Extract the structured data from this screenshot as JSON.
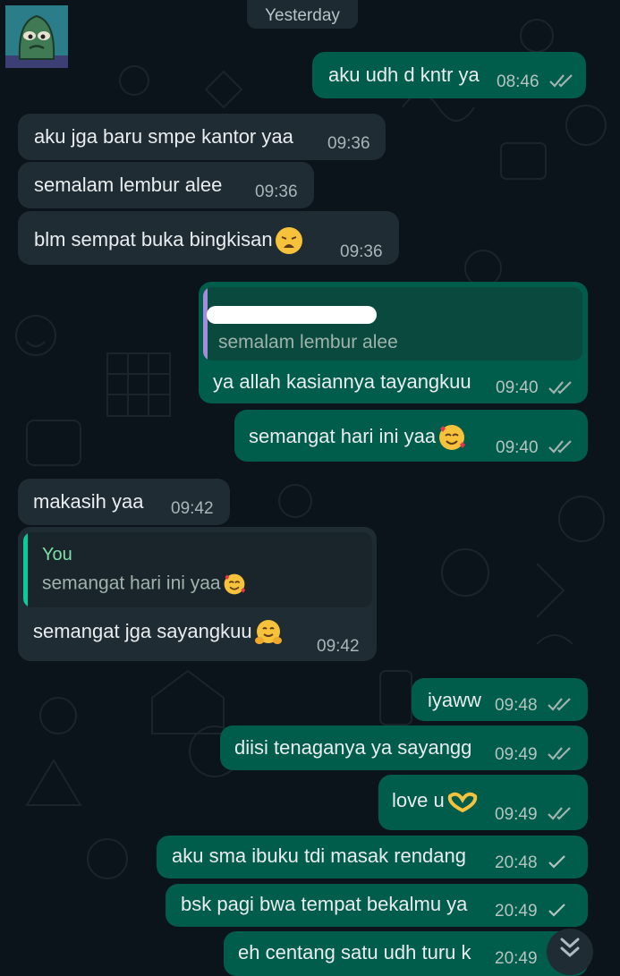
{
  "date_chip": "Yesterday",
  "messages": [
    {
      "text": "aku udh d kntr ya",
      "time": "08:46",
      "status": "read"
    },
    {
      "text": "aku jga baru smpe kantor yaa",
      "time": "09:36"
    },
    {
      "text": "semalam lembur alee",
      "time": "09:36"
    },
    {
      "text": "blm sempat buka bingkisan",
      "time": "09:36",
      "emoji": "weary-face"
    },
    {
      "reply_to_text": "semalam lembur alee",
      "text": "ya allah kasiannya tayangkuu",
      "time": "09:40",
      "status": "read"
    },
    {
      "text": "semangat hari ini yaa",
      "time": "09:40",
      "status": "read",
      "emoji": "smiling-face-with-hearts"
    },
    {
      "text": "makasih yaa",
      "time": "09:42"
    },
    {
      "reply_to_author": "You",
      "reply_to_text": "semangat hari ini yaa",
      "text": "semangat jga sayangkuu",
      "time": "09:42",
      "emoji": "hugging-face"
    },
    {
      "text": "iyaww",
      "time": "09:48",
      "status": "read"
    },
    {
      "text": "diisi tenaganya ya sayangg",
      "time": "09:49",
      "status": "read"
    },
    {
      "text": "love u",
      "time": "09:49",
      "status": "read",
      "emoji": "heart-hands"
    },
    {
      "text": "aku sma ibuku tdi masak rendang",
      "time": "20:48",
      "status": "sent"
    },
    {
      "text": "bsk pagi bwa tempat bekalmu ya",
      "time": "20:49",
      "status": "sent"
    },
    {
      "text": "eh centang satu udh turu k",
      "time": "20:49"
    }
  ],
  "colors": {
    "background": "#0b141a",
    "incoming_bubble": "#1f2c33",
    "outgoing_bubble": "#005c4b",
    "read_ticks": "#9fb4ae",
    "reply_author": "#7fe0a6",
    "reply_bar_out": "#a58bdc"
  }
}
